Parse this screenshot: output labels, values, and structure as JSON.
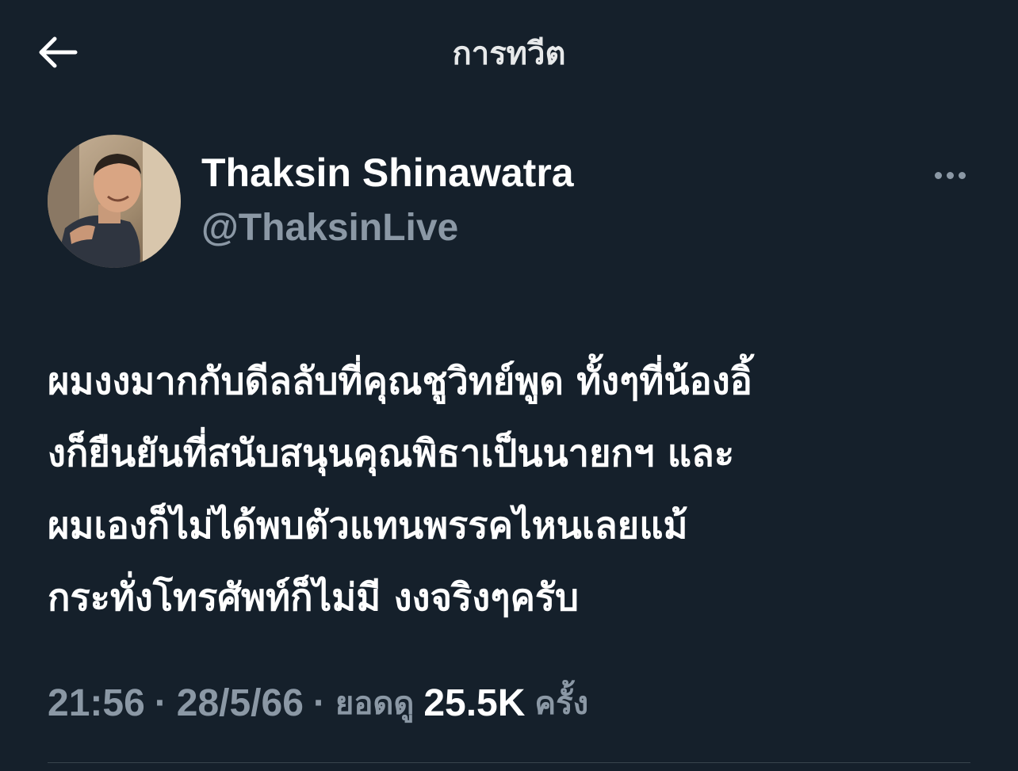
{
  "header": {
    "title": "การทวีต",
    "back_icon": "arrow-left-icon"
  },
  "author": {
    "display_name": "Thaksin Shinawatra",
    "handle": "@ThaksinLive",
    "avatar_icon": "profile-photo",
    "more_icon": "more-horizontal-icon"
  },
  "tweet": {
    "lines": [
      "ผมงงมากกับดีลลับที่คุณชูวิทย์พูด ทั้งๆที่น้องอิ้",
      "งก็ยืนยันที่สนับสนุนคุณพิธาเป็นนายกฯ และ",
      "ผมเองก็ไม่ได้พบตัวแทนพรรคไหนเลยแม้",
      "กระทั่งโทรศัพท์ก็ไม่มี งงจริงๆครับ"
    ]
  },
  "meta": {
    "time": "21:56",
    "date": "28/5/66",
    "separator": "·",
    "views_label": "ยอดดู",
    "views_count": "25.5K",
    "views_unit": "ครั้ง"
  },
  "colors": {
    "background": "#15202b",
    "primary_text": "#ffffff",
    "secondary_text": "#8b98a5",
    "divider": "#38444d"
  }
}
